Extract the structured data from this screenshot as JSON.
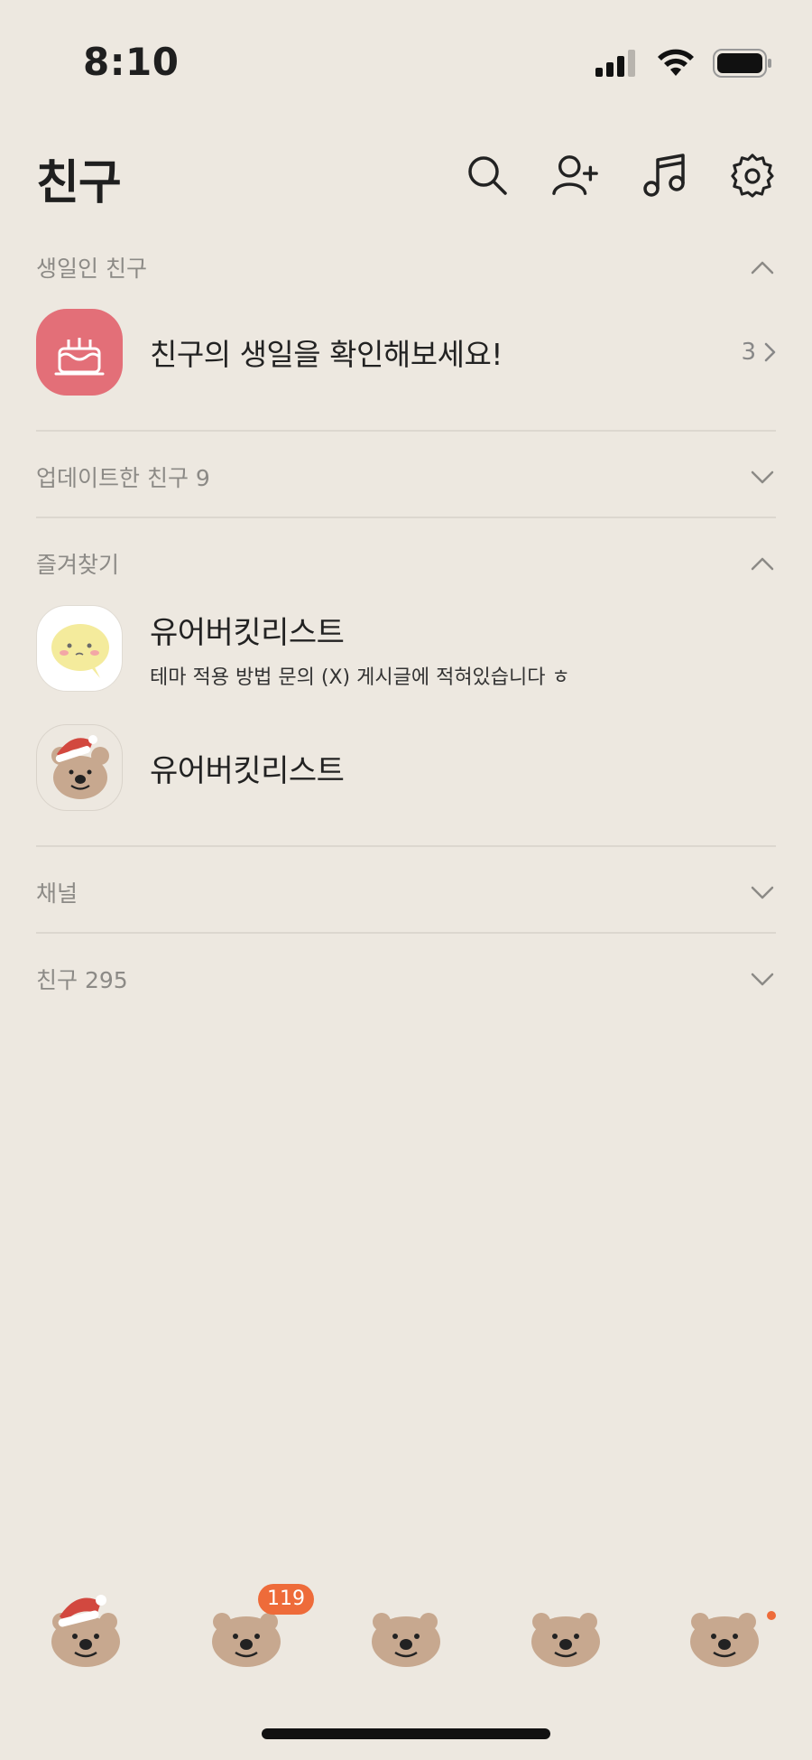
{
  "status_bar": {
    "time": "8:10"
  },
  "header": {
    "title": "친구"
  },
  "birthday_section": {
    "title": "생일인 친구",
    "row_text": "친구의 생일을 확인해보세요!",
    "count": "3"
  },
  "updated_section": {
    "title": "업데이트한 친구 9"
  },
  "favorites_section": {
    "title": "즐겨찾기",
    "items": [
      {
        "name": "유어버킷리스트",
        "status": "테마 적용 방법 문의 (X) 게시글에 적혀있습니다 ㅎ"
      },
      {
        "name": "유어버킷리스트"
      }
    ]
  },
  "channel_section": {
    "title": "채널"
  },
  "friends_section": {
    "title": "친구 295"
  },
  "tab_bar": {
    "chats_badge": "119"
  },
  "colors": {
    "background": "#EDE8E0",
    "badge": "#EE6B3A",
    "birthday_icon": "#E36F78",
    "bear": "#C7A88F"
  }
}
